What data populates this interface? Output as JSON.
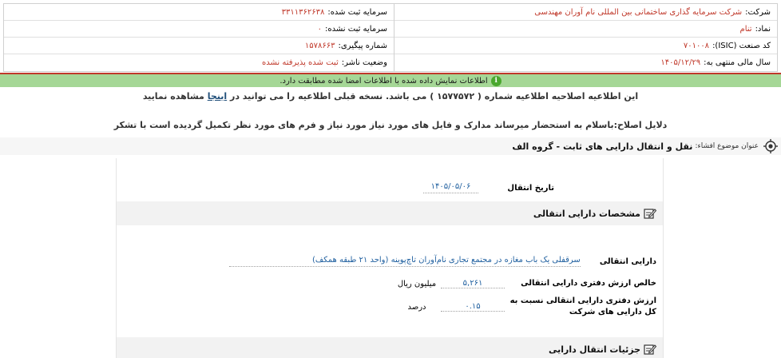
{
  "company": {
    "company_label": "شرکت:",
    "company_value": "شرکت سرمایه گذاری ساختمانی بین المللی نام آوران مهندسی",
    "symbol_label": "نماد:",
    "symbol_value": "تنام",
    "isic_label": "کد صنعت (ISIC):",
    "isic_value": "۷۰۱۰۰۸",
    "fiscal_label": "سال مالی منتهی به:",
    "fiscal_value": "۱۴۰۵/۱۲/۲۹",
    "registered_capital_label": "سرمایه ثبت شده:",
    "registered_capital_value": "۳۳۱۱۳۶۲۶۳۸",
    "unregistered_capital_label": "سرمایه ثبت نشده:",
    "unregistered_capital_value": "۰",
    "tracking_label": "شماره پیگیری:",
    "tracking_value": "۱۵۷۸۶۶۳",
    "publisher_status_label": "وضعیت ناشر:",
    "publisher_status_value": "ثبت شده پذیرفته نشده"
  },
  "notice": {
    "icon": "info-icon",
    "text": "اطلاعات نمایش داده شده با اطلاعات امضا شده مطابقت دارد."
  },
  "correction": {
    "line1_before": "این اطلاعیه اصلاحیه اطلاعیه شماره ( ۱۵۷۷۵۷۲ ) می باشد. نسخه قبلی اطلاعیه را می توانید در ",
    "line1_link": "اینجا",
    "line1_after": " مشاهده نمایید",
    "reason": "دلایل اصلاح:باسلام به استحضار میرساند مدارک و فایل های مورد نیاز مورد نیاز و فرم های مورد نظر تکمیل گردیده است با تشکر"
  },
  "subject": {
    "label": "عنوان موضوع افشاء:",
    "value": "نقل و انتقال دارایی های ثابت - گروه الف"
  },
  "transfer": {
    "date_label": "تاریخ انتقال",
    "date_value": "۱۴۰۵/۰۵/۰۶"
  },
  "section_asset_specs": {
    "title": "مشخصات دارایی انتقالی"
  },
  "asset": {
    "asset_label": "دارایی انتقالی",
    "asset_value": "سرقفلی یک باب مغازه در مجتمع تجاری نام‌آوران تاچ‌پوینه (واحد ۲۱ طبقه همکف)",
    "book_value_label": "خالص ارزش دفتری دارایی انتقالی",
    "book_value_value": "۵,۲۶۱",
    "book_value_unit": "میلیون ریال",
    "ratio_label": "ارزش دفتری دارایی انتقالی نسبت به کل دارایی های شرکت",
    "ratio_value": "۰.۱۵",
    "ratio_unit": "درصد"
  },
  "section_transfer_details": {
    "title": "جزئیات انتقال دارایی"
  }
}
